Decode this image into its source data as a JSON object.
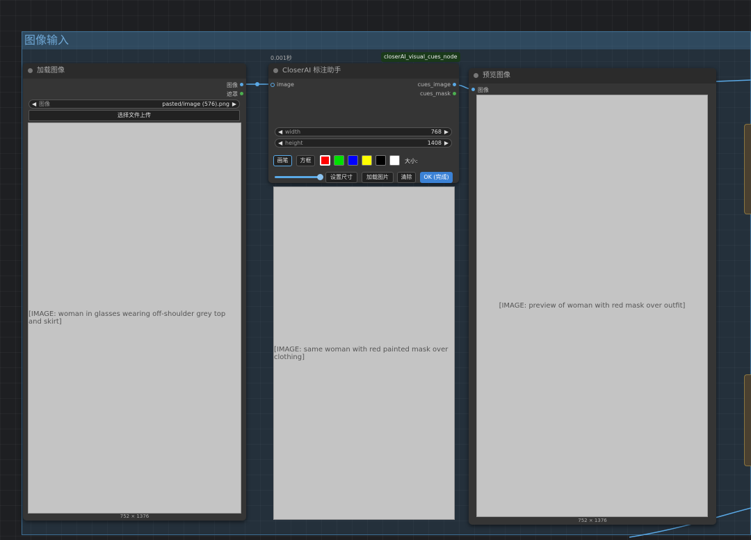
{
  "group": {
    "title": "图像输入"
  },
  "timer": "0.001秒",
  "node_badge": "closerAI_visual_cues_node",
  "load_node": {
    "title": "加载图像",
    "outputs": [
      "图像",
      "遮罩"
    ],
    "image_widget": {
      "label": "图像",
      "value": "pasted/image (576).png"
    },
    "upload_button": "选择文件上传",
    "image_caption": "[IMAGE: woman in glasses wearing off-shoulder grey top and skirt]",
    "dims": "752 × 1376"
  },
  "closer_node": {
    "title": "CloserAI 标注助手",
    "input": "image",
    "outputs": [
      "cues_image",
      "cues_mask"
    ],
    "width": {
      "label": "width",
      "value": "768"
    },
    "height": {
      "label": "height",
      "value": "1408"
    },
    "tools": {
      "pen": "画笔",
      "box": "方框",
      "size": "大小:"
    },
    "colors": [
      "#ff0000",
      "#00e000",
      "#0000ff",
      "#ffff00",
      "#000000",
      "#ffffff"
    ],
    "brush_level": 1.0,
    "buttons": {
      "set_size": "设置尺寸",
      "load_image": "加载图片",
      "clear": "清除",
      "ok": "OK (完成)"
    },
    "image_caption": "[IMAGE: same woman with red painted mask over clothing]"
  },
  "preview_node": {
    "title": "预览图像",
    "input": "图像",
    "image_caption": "[IMAGE: preview of woman with red mask over outfit]",
    "dims": "752 × 1376"
  },
  "colors": {
    "wire": "#5aa9e6",
    "accent_button": "#3b82d6",
    "group_border": "#3d6f96"
  }
}
